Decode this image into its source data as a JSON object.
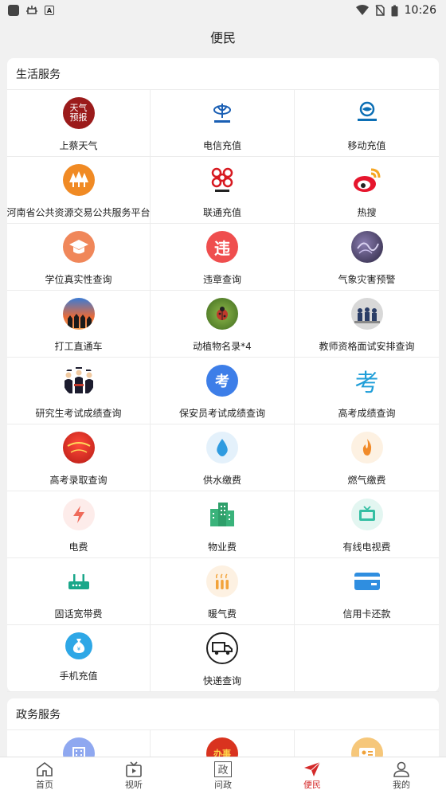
{
  "status_bar": {
    "time": "10:26"
  },
  "header": {
    "title": "便民"
  },
  "sections": [
    {
      "title": "生活服务",
      "items": [
        {
          "label": "上蔡天气",
          "icon": "weather-icon",
          "icon_text": "天气预报"
        },
        {
          "label": "电信充值",
          "icon": "china-telecom-icon"
        },
        {
          "label": "移动充值",
          "icon": "china-mobile-icon"
        },
        {
          "label": "河南省公共资源交易公共服务平台",
          "icon": "forest-icon"
        },
        {
          "label": "联通充值",
          "icon": "china-unicom-icon"
        },
        {
          "label": "热搜",
          "icon": "weibo-icon"
        },
        {
          "label": "学位真实性查询",
          "icon": "graduation-cap-icon"
        },
        {
          "label": "违章查询",
          "icon": "violation-icon",
          "icon_text": "违"
        },
        {
          "label": "气象灾害预警",
          "icon": "weather-warning-icon"
        },
        {
          "label": "打工直通车",
          "icon": "job-icon"
        },
        {
          "label": "动植物名录*4",
          "icon": "ladybug-icon"
        },
        {
          "label": "教师资格面试安排查询",
          "icon": "teacher-icon"
        },
        {
          "label": "研究生考试成绩查询",
          "icon": "graduates-icon"
        },
        {
          "label": "保安员考试成绩查询",
          "icon": "exam-icon",
          "icon_text": "考"
        },
        {
          "label": "高考成绩查询",
          "icon": "gaokao-icon",
          "icon_text": "考"
        },
        {
          "label": "高考录取查询",
          "icon": "admission-icon"
        },
        {
          "label": "供水缴费",
          "icon": "water-drop-icon"
        },
        {
          "label": "燃气缴费",
          "icon": "flame-icon"
        },
        {
          "label": "电费",
          "icon": "lightning-icon"
        },
        {
          "label": "物业费",
          "icon": "buildings-icon"
        },
        {
          "label": "有线电视费",
          "icon": "tv-icon"
        },
        {
          "label": "固话宽带费",
          "icon": "router-icon"
        },
        {
          "label": "暖气费",
          "icon": "heater-icon"
        },
        {
          "label": "信用卡还款",
          "icon": "credit-card-icon"
        },
        {
          "label": "手机充值",
          "icon": "money-bag-icon"
        },
        {
          "label": "快递查询",
          "icon": "delivery-truck-icon"
        }
      ]
    },
    {
      "title": "政务服务",
      "items": [
        {
          "label": "",
          "icon": "building-icon"
        },
        {
          "label": "",
          "icon": "govt-service-icon",
          "icon_text": "办事"
        },
        {
          "label": "",
          "icon": "id-card-icon"
        }
      ]
    }
  ],
  "tabbar": [
    {
      "label": "首页",
      "icon": "home-icon",
      "active": false
    },
    {
      "label": "视听",
      "icon": "video-icon",
      "active": false
    },
    {
      "label": "问政",
      "icon": "question-govt-icon",
      "icon_text": "政",
      "active": false
    },
    {
      "label": "便民",
      "icon": "paper-plane-icon",
      "active": true
    },
    {
      "label": "我的",
      "icon": "person-icon",
      "active": false
    }
  ],
  "colors": {
    "accent": "#d42a2a",
    "background": "#f1f1f1"
  }
}
